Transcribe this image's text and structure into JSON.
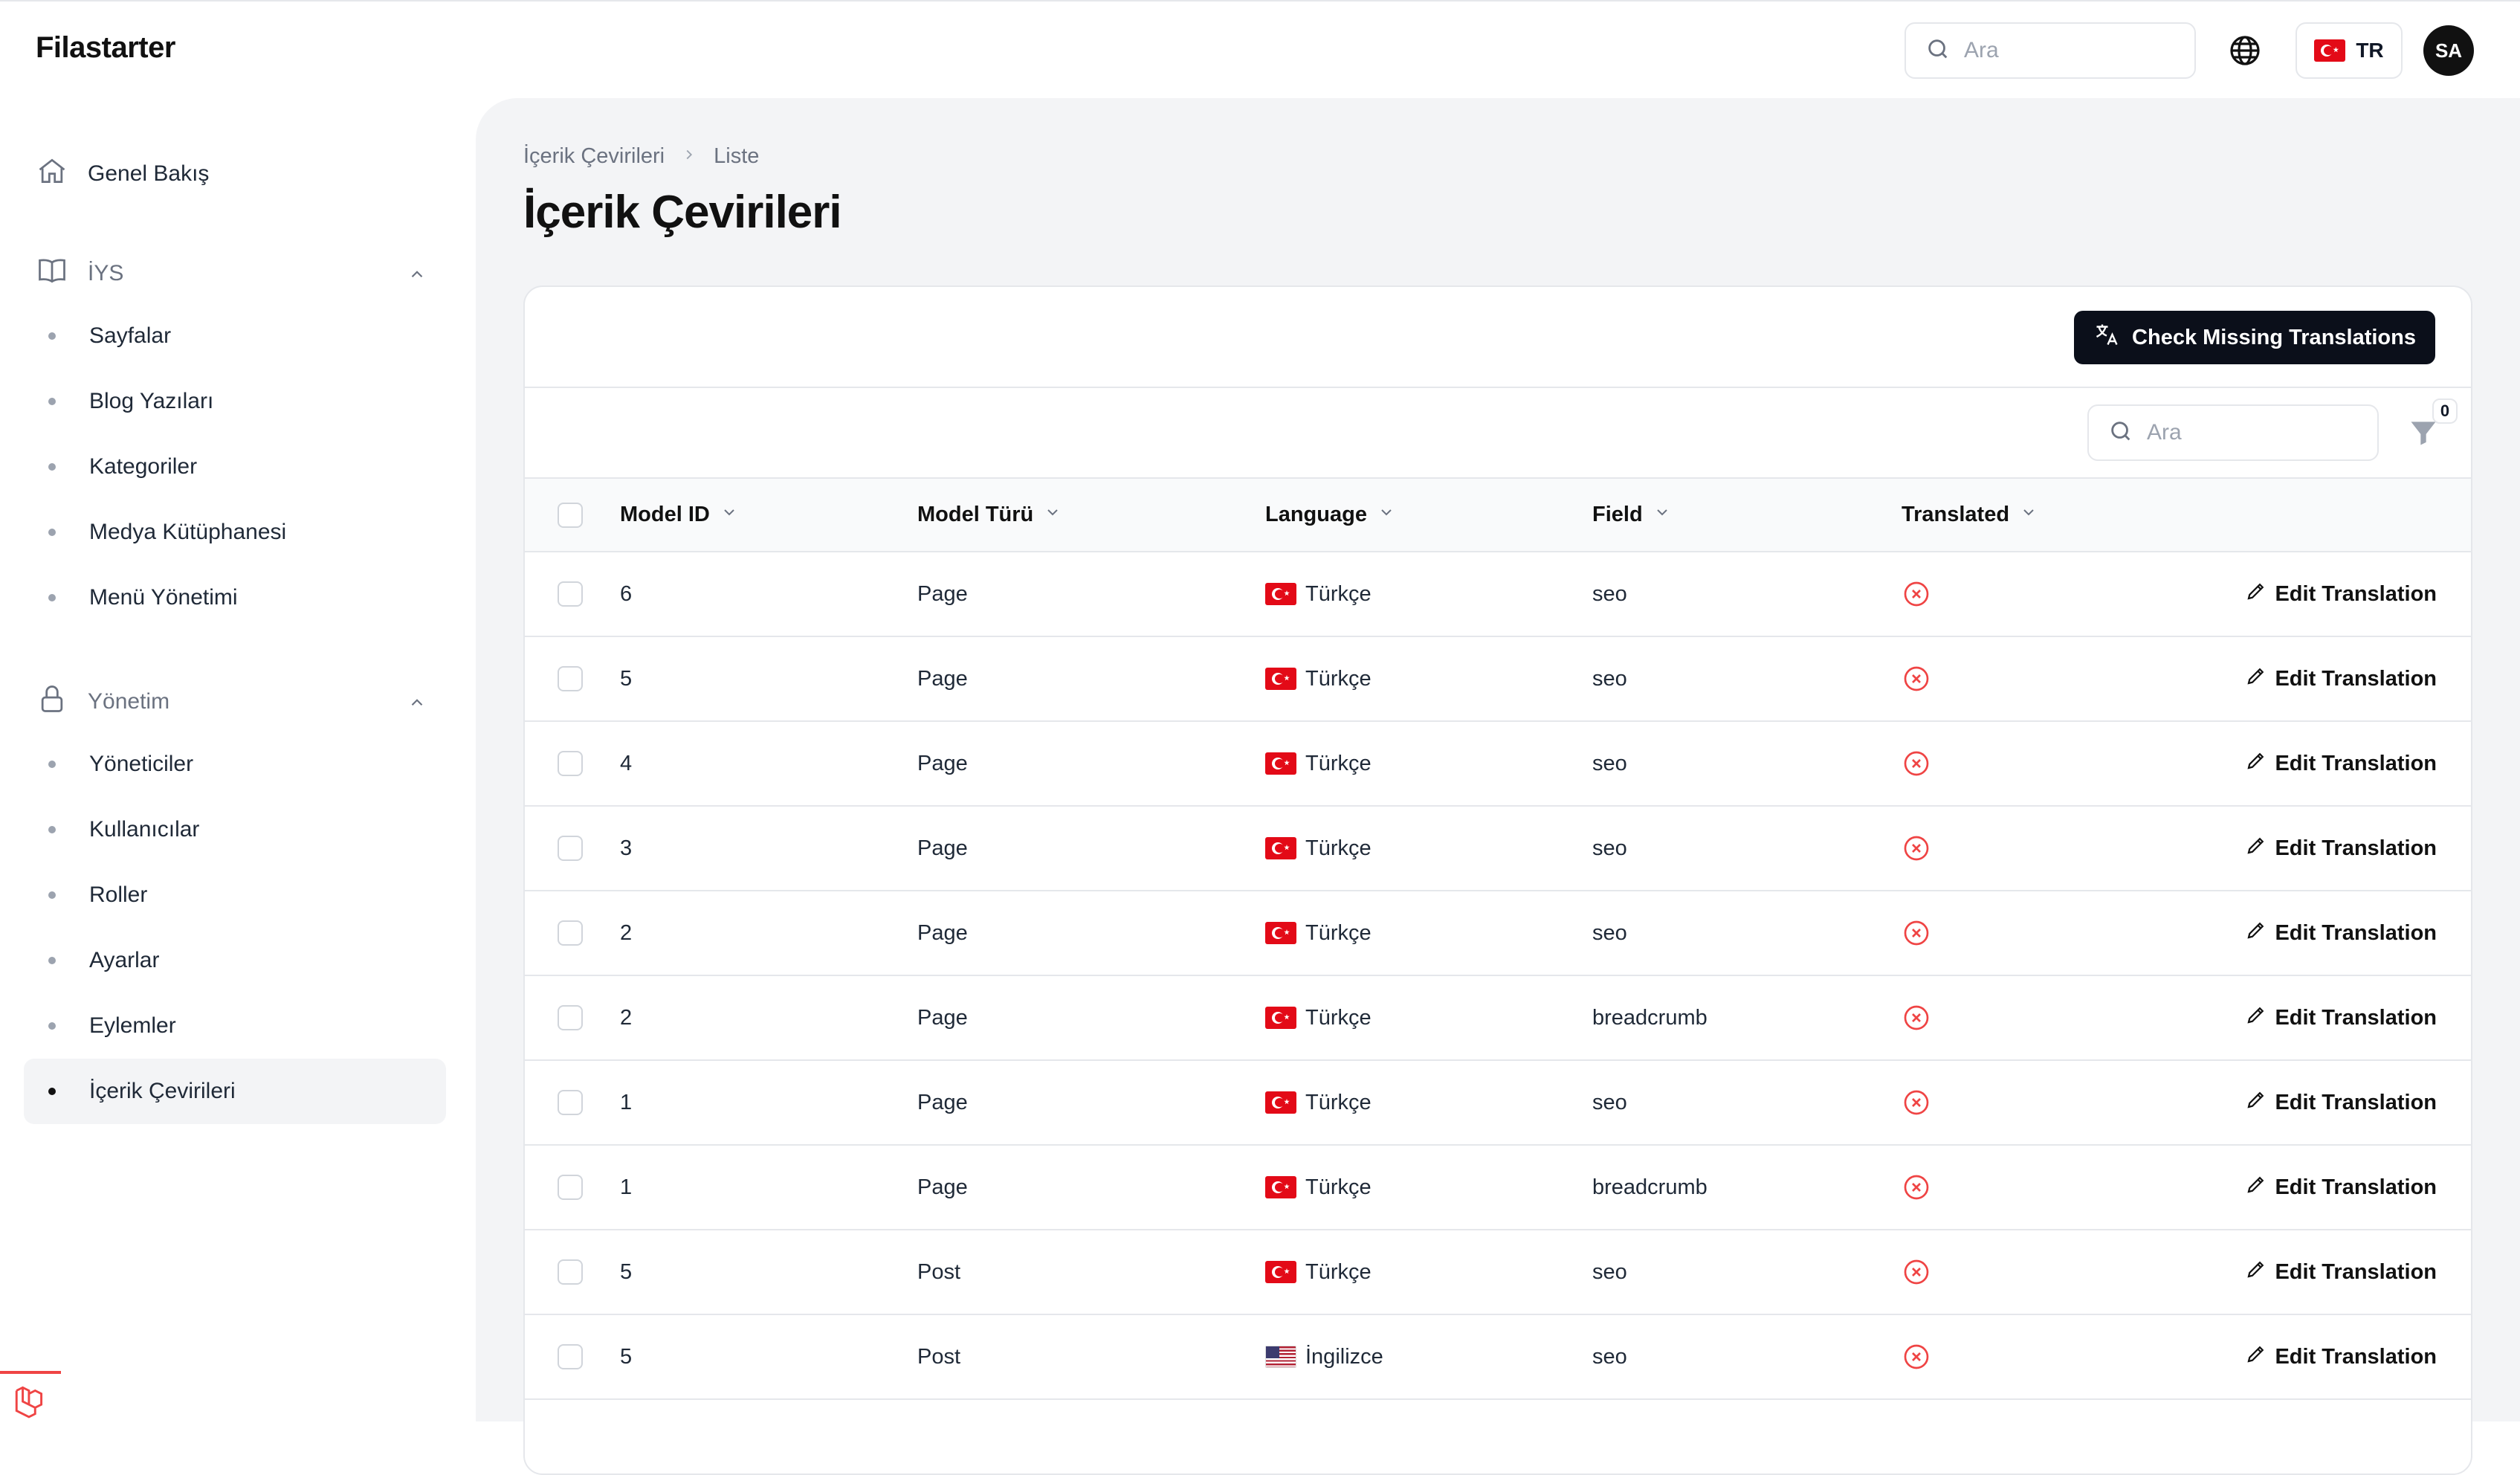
{
  "app": {
    "brand": "Filastarter"
  },
  "topbar": {
    "search_placeholder": "Ara",
    "language_code": "TR",
    "user_initials": "SA"
  },
  "sidebar": {
    "overview": "Genel Bakış",
    "groups": [
      {
        "label": "İYS",
        "items": [
          "Sayfalar",
          "Blog Yazıları",
          "Kategoriler",
          "Medya Kütüphanesi",
          "Menü Yönetimi"
        ]
      },
      {
        "label": "Yönetim",
        "items": [
          "Yöneticiler",
          "Kullanıcılar",
          "Roller",
          "Ayarlar",
          "Eylemler",
          "İçerik Çevirileri"
        ]
      }
    ],
    "active_item": "İçerik Çevirileri"
  },
  "breadcrumb": {
    "parent": "İçerik Çevirileri",
    "current": "Liste"
  },
  "page": {
    "title": "İçerik Çevirileri"
  },
  "actions": {
    "check_missing": "Check Missing Translations"
  },
  "table": {
    "search_placeholder": "Ara",
    "filter_count": "0",
    "columns": [
      "Model ID",
      "Model Türü",
      "Language",
      "Field",
      "Translated"
    ],
    "action_label": "Edit Translation",
    "rows": [
      {
        "model_id": "6",
        "model_type": "Page",
        "language": "Türkçe",
        "flag": "tr",
        "field": "seo",
        "translated": false
      },
      {
        "model_id": "5",
        "model_type": "Page",
        "language": "Türkçe",
        "flag": "tr",
        "field": "seo",
        "translated": false
      },
      {
        "model_id": "4",
        "model_type": "Page",
        "language": "Türkçe",
        "flag": "tr",
        "field": "seo",
        "translated": false
      },
      {
        "model_id": "3",
        "model_type": "Page",
        "language": "Türkçe",
        "flag": "tr",
        "field": "seo",
        "translated": false
      },
      {
        "model_id": "2",
        "model_type": "Page",
        "language": "Türkçe",
        "flag": "tr",
        "field": "seo",
        "translated": false
      },
      {
        "model_id": "2",
        "model_type": "Page",
        "language": "Türkçe",
        "flag": "tr",
        "field": "breadcrumb",
        "translated": false
      },
      {
        "model_id": "1",
        "model_type": "Page",
        "language": "Türkçe",
        "flag": "tr",
        "field": "seo",
        "translated": false
      },
      {
        "model_id": "1",
        "model_type": "Page",
        "language": "Türkçe",
        "flag": "tr",
        "field": "breadcrumb",
        "translated": false
      },
      {
        "model_id": "5",
        "model_type": "Post",
        "language": "Türkçe",
        "flag": "tr",
        "field": "seo",
        "translated": false
      },
      {
        "model_id": "5",
        "model_type": "Post",
        "language": "İngilizce",
        "flag": "us",
        "field": "seo",
        "translated": false
      }
    ]
  },
  "colors": {
    "danger": "#ef4444",
    "primary_button": "#0b0f1a",
    "page_bg": "#f3f4f6"
  }
}
